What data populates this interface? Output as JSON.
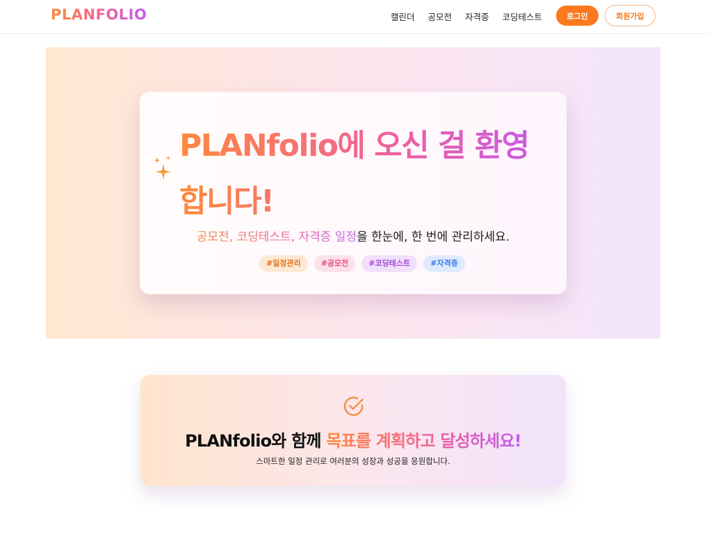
{
  "header": {
    "logo": "PLANFOLIO",
    "nav": [
      "캘린더",
      "공모전",
      "자격증",
      "코딩테스트"
    ],
    "login_label": "로그인",
    "signup_label": "회원가입"
  },
  "hero": {
    "title": "PLANfolio에 오신 걸 환영합니다!",
    "subtitle_highlight": "공모전, 코딩테스트, 자격증 일정",
    "subtitle_rest": "을 한눈에, 한 번에 관리하세요.",
    "tags": [
      "#일정관리",
      "#공모전",
      "#코딩테스트",
      "#자격증"
    ],
    "sparkle_icon": "sparkle-icon"
  },
  "goal": {
    "check_icon": "check-circle-icon",
    "title_prefix": "PLANfolio와 함께 ",
    "title_highlight": "목표를 계획하고 달성하세요!",
    "subtitle": "스마트한 일정 관리로 여러분의 성장과 성공을 응원합니다."
  },
  "colors": {
    "accent_orange": "#fb7a1e",
    "gradient_start": "#ff8a3d",
    "gradient_mid": "#f0619a",
    "gradient_end": "#c35cf0"
  }
}
